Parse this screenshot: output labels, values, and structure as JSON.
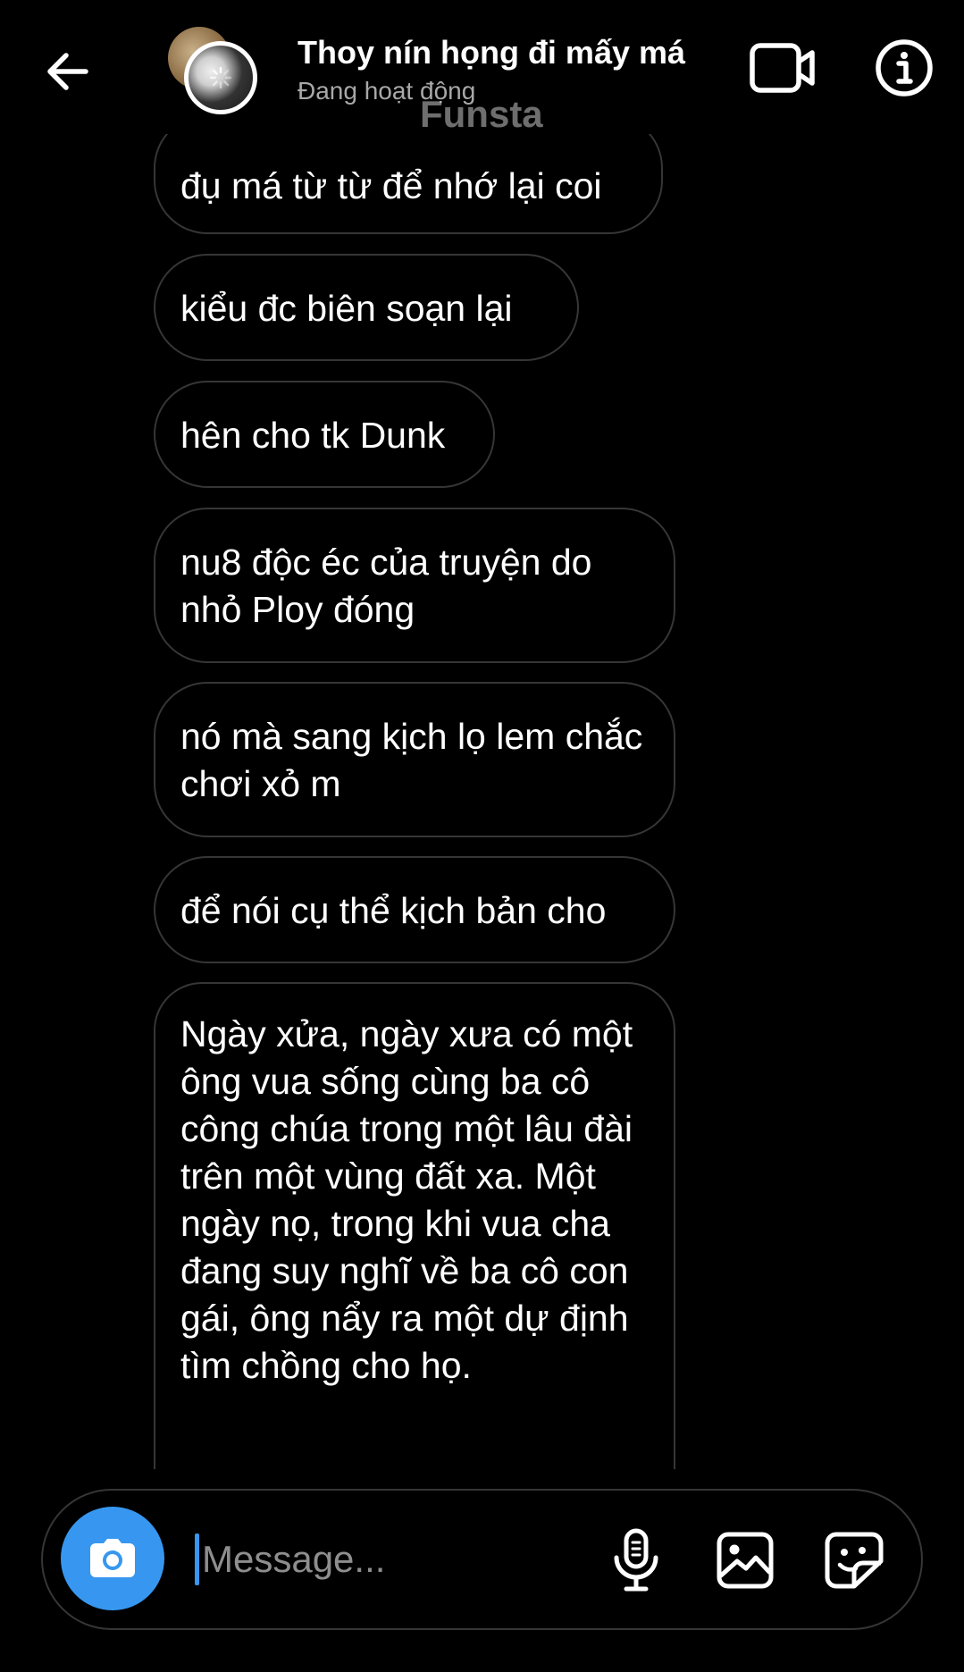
{
  "header": {
    "title": "Thoy nín họng đi mấy má",
    "status": "Đang hoạt động",
    "watermark": "Funsta",
    "icons": {
      "back": "arrow-left-icon",
      "video": "video-camera-icon",
      "info": "info-icon"
    }
  },
  "messages": [
    "đụ má từ từ để nhớ lại coi",
    "kiểu đc biên soạn lại",
    "hên cho tk Dunk",
    "nu8 độc éc của truyện do nhỏ Ploy đóng",
    "nó mà sang kịch lọ lem chắc chơi xỏ m",
    "để nói cụ thể kịch bản cho",
    "Ngày xửa, ngày xưa có một ông vua sống cùng ba cô công chúa trong một lâu đài trên một vùng đất xa. Một ngày nọ, trong khi vua cha đang suy nghĩ về ba cô con gái, ông nẩy ra một dự định tìm chồng cho họ."
  ],
  "composer": {
    "placeholder": "Message...",
    "icons": {
      "camera": "camera-icon",
      "mic": "microphone-icon",
      "gallery": "image-icon",
      "sticker": "sticker-icon"
    }
  },
  "colors": {
    "background": "#000000",
    "bubble_border": "#363636",
    "accent": "#3797f0",
    "status_text": "#a8a8a8"
  }
}
